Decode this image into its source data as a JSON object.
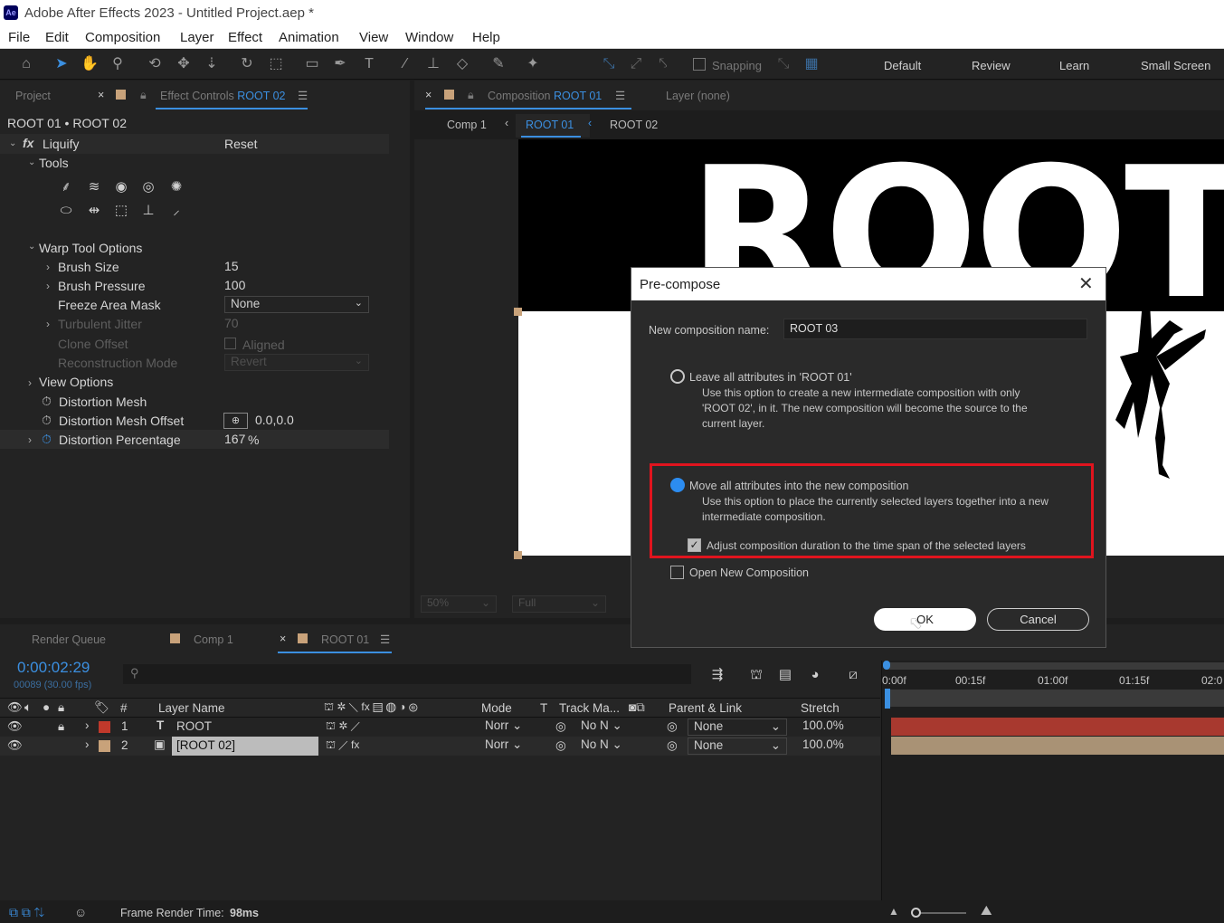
{
  "app": {
    "title": "Adobe After Effects 2023 - Untitled Project.aep *",
    "logo_text": "Ae"
  },
  "menu": [
    "File",
    "Edit",
    "Composition",
    "Layer",
    "Effect",
    "Animation",
    "View",
    "Window",
    "Help"
  ],
  "toolbar": {
    "snapping_label": "Snapping",
    "workspaces": [
      "Default",
      "Review",
      "Learn",
      "Small Screen"
    ]
  },
  "left_panel": {
    "tab_project": "Project",
    "tab_effect_controls_prefix": "Effect Controls",
    "tab_effect_controls_target": "ROOT 02",
    "header": "ROOT 01 • ROOT 02",
    "effect_name": "Liquify",
    "reset_label": "Reset",
    "tools_label": "Tools",
    "warp_tool_options_label": "Warp Tool Options",
    "brush_size_label": "Brush Size",
    "brush_size_value": "15",
    "brush_pressure_label": "Brush Pressure",
    "brush_pressure_value": "100",
    "freeze_area_mask_label": "Freeze Area Mask",
    "freeze_area_mask_value": "None",
    "turbulent_jitter_label": "Turbulent Jitter",
    "turbulent_jitter_value": "70",
    "clone_offset_label": "Clone Offset",
    "aligned_label": "Aligned",
    "reconstruction_mode_label": "Reconstruction Mode",
    "reconstruction_mode_value": "Revert",
    "view_options_label": "View Options",
    "distortion_mesh_label": "Distortion Mesh",
    "distortion_mesh_offset_label": "Distortion Mesh Offset",
    "distortion_mesh_offset_value": "0.0,0.0",
    "distortion_percentage_label": "Distortion Percentage",
    "distortion_percentage_value": "167",
    "distortion_percentage_unit": "%"
  },
  "comp_panel": {
    "tab_prefix": "Composition",
    "tab_target": "ROOT 01",
    "layer_tab": "Layer (none)",
    "breadcrumbs": [
      "Comp 1",
      "ROOT 01",
      "ROOT 02"
    ],
    "canvas_text": "ROOT",
    "zoom_value": "50%",
    "resolution_value": "Full"
  },
  "dialog": {
    "title": "Pre-compose",
    "name_label": "New composition name:",
    "name_value": "ROOT 03",
    "option1_label": "Leave all attributes in 'ROOT 01'",
    "option1_desc_lines": [
      "Use this option to create a new intermediate composition with only",
      "'ROOT 02', in it. The new composition will become the source to the",
      "current layer."
    ],
    "option2_label": "Move all attributes into the new composition",
    "option2_desc_lines": [
      "Use this option to place the currently selected layers together into a new",
      "intermediate composition."
    ],
    "adjust_label": "Adjust composition duration to the time span of the selected layers",
    "open_new_label": "Open New Composition",
    "ok_label": "OK",
    "cancel_label": "Cancel",
    "highlight_color": "#e0141e"
  },
  "timeline": {
    "tabs": [
      "Render Queue",
      "Comp 1",
      "ROOT 01"
    ],
    "timecode": "0:00:02:29",
    "frame_info": "00089 (30.00 fps)",
    "search_placeholder": "",
    "columns": {
      "num": "#",
      "layer_name": "Layer Name",
      "mode": "Mode",
      "t": "T",
      "track_matte": "Track Ma...",
      "parent": "Parent & Link",
      "stretch": "Stretch"
    },
    "ruler": [
      "0:00f",
      "00:15f",
      "01:00f",
      "01:15f",
      "02:0"
    ],
    "layers": [
      {
        "num": "1",
        "name": "ROOT",
        "type_glyph": "T",
        "mode": "Norr",
        "track": "No N",
        "parent": "None",
        "stretch": "100.0%",
        "color": "#c0392b"
      },
      {
        "num": "2",
        "name": "[ROOT 02]",
        "type_glyph": "▣",
        "mode": "Norr",
        "track": "No N",
        "parent": "None",
        "stretch": "100.0%",
        "color": "#c8a27a"
      }
    ],
    "status_label": "Frame Render Time:",
    "status_value": "98ms"
  }
}
